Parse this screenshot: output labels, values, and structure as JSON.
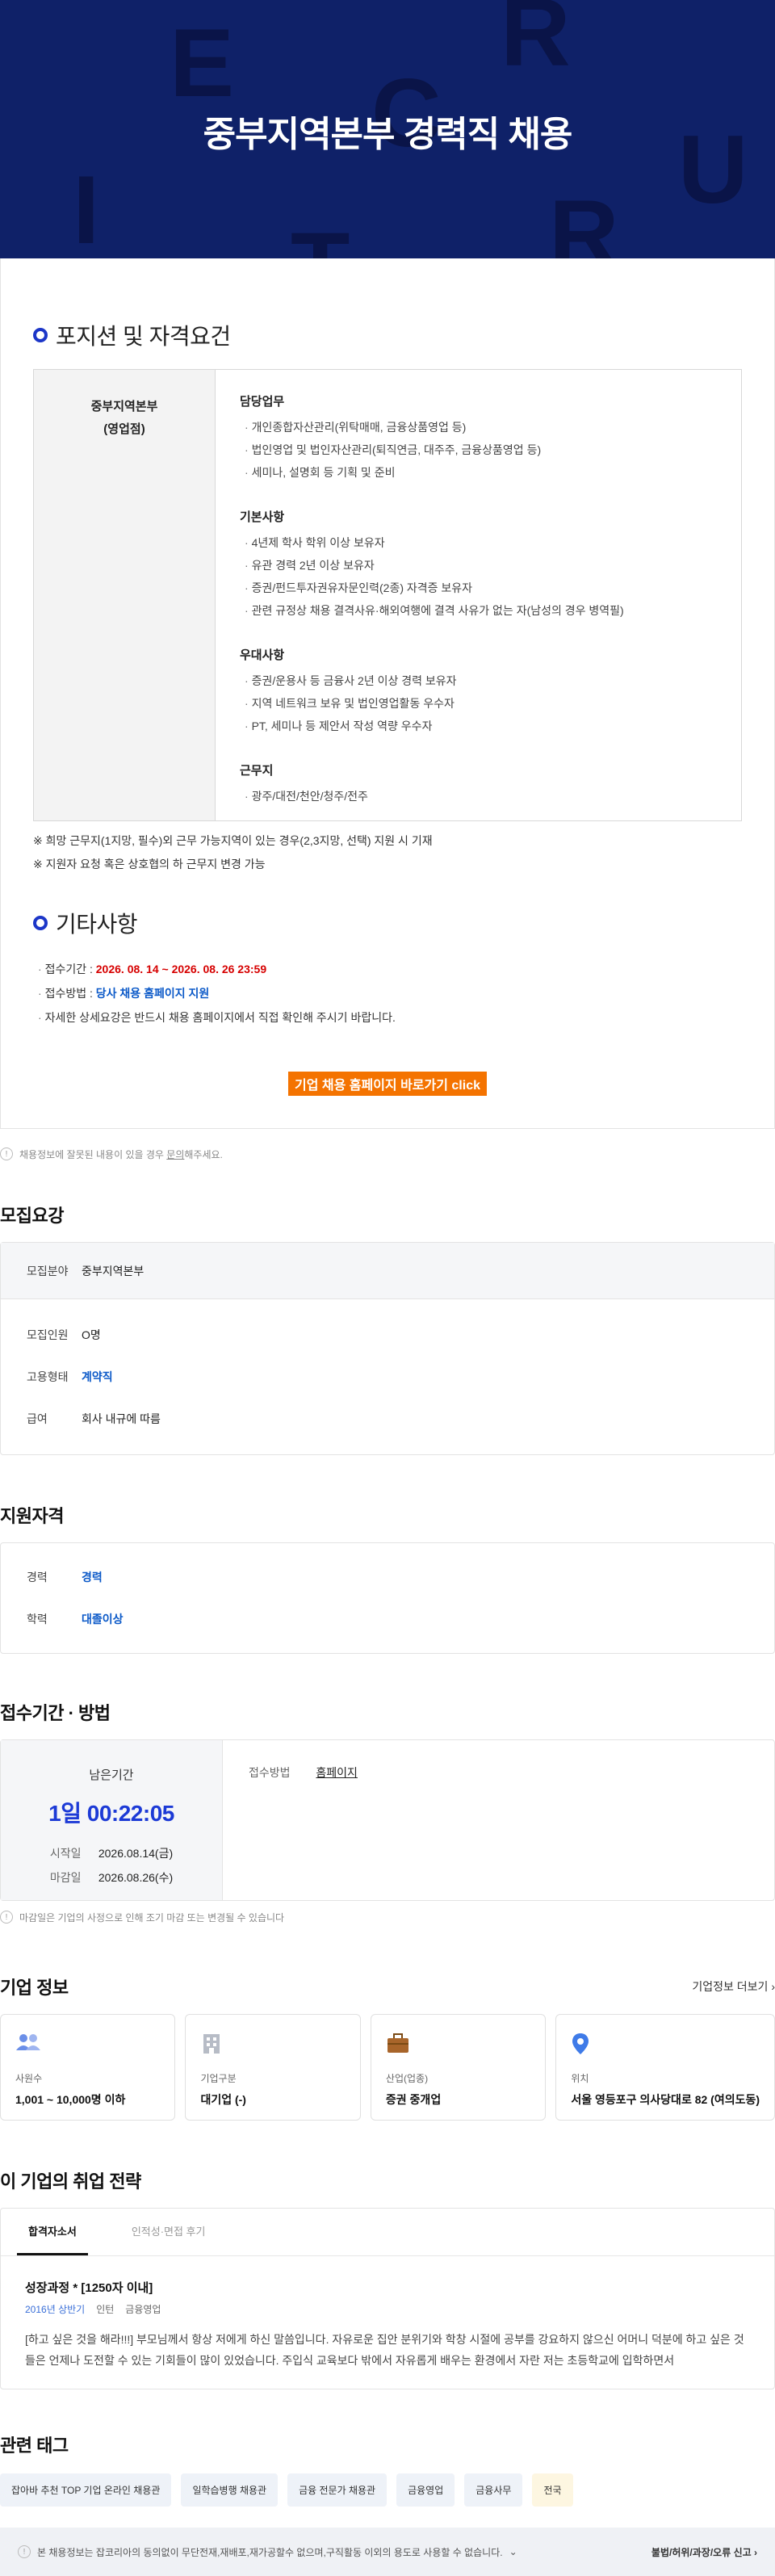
{
  "hero": {
    "title": "중부지역본부 경력직 채용",
    "bg_letters": [
      "E",
      "R",
      "C",
      "U",
      "I",
      "T",
      "R"
    ]
  },
  "position": {
    "section_title": "포지션 및 자격요건",
    "dept_line1": "중부지역본부",
    "dept_line2": "(영업점)",
    "groups": [
      {
        "title": "담당업무",
        "items": [
          "개인종합자산관리(위탁매매, 금융상품영업 등)",
          "법인영업 및 법인자산관리(퇴직연금, 대주주, 금융상품영업 등)",
          "세미나, 설명회 등 기획 및 준비"
        ]
      },
      {
        "title": "기본사항",
        "items": [
          "4년제 학사 학위 이상 보유자",
          "유관 경력 2년 이상 보유자",
          "증권/펀드투자권유자문인력(2종) 자격증 보유자",
          "관련 규정상 채용 결격사유·해외여행에 결격 사유가 없는 자(남성의 경우 병역필)"
        ]
      },
      {
        "title": "우대사항",
        "items": [
          "증권/운용사 등 금융사 2년 이상 경력 보유자",
          "지역 네트워크 보유 및 법인영업활동 우수자",
          "PT, 세미나 등 제안서 작성 역량 우수자"
        ]
      },
      {
        "title": "근무지",
        "items": [
          "광주/대전/천안/청주/전주"
        ]
      }
    ],
    "notes": [
      "※ 희망 근무지(1지망, 필수)외 근무 가능지역이 있는 경우(2,3지망, 선택) 지원 시 기재",
      "※ 지원자 요청 혹은 상호협의 하 근무지 변경 가능"
    ]
  },
  "etc": {
    "section_title": "기타사항",
    "period_label": "접수기간 : ",
    "period_value": "2026. 08. 14 ~ 2026. 08. 26 23:59",
    "method_label": "접수방법 : ",
    "method_value": "당사 채용 홈페이지 지원",
    "detail": "자세한 상세요강은 반드시 채용 홈페이지에서 직접 확인해 주시기 바랍니다.",
    "cta": "기업 채용 홈페이지 바로가기 click"
  },
  "report": {
    "pre": "채용정보에 잘못된 내용이 있을 경우 ",
    "link": "문의",
    "post": "해주세요."
  },
  "recruit": {
    "title": "모집요강",
    "rows": [
      {
        "label": "모집분야",
        "value": "중부지역본부",
        "blue": false
      },
      {
        "label": "모집인원",
        "value": "O명",
        "blue": false
      },
      {
        "label": "고용형태",
        "value": "계약직",
        "blue": true
      },
      {
        "label": "급여",
        "value": "회사 내규에 따름",
        "blue": false
      }
    ]
  },
  "qualification": {
    "title": "지원자격",
    "rows": [
      {
        "label": "경력",
        "value": "경력"
      },
      {
        "label": "학력",
        "value": "대졸이상"
      }
    ]
  },
  "apply": {
    "title": "접수기간 · 방법",
    "remain_label": "남은기간",
    "remain_value": "1일 00:22:05",
    "start_label": "시작일",
    "start_value": "2026.08.14(금)",
    "end_label": "마감일",
    "end_value": "2026.08.26(수)",
    "method_label": "접수방법",
    "method_value": "홈페이지",
    "notice": "마감일은 기업의 사정으로 인해 조기 마감 또는 변경될 수 있습니다"
  },
  "company": {
    "title": "기업 정보",
    "more": "기업정보 더보기",
    "cards": [
      {
        "icon": "people-icon",
        "label": "사원수",
        "value": "1,001 ~ 10,000명 이하"
      },
      {
        "icon": "building-icon",
        "label": "기업구분",
        "value": "대기업 (-)"
      },
      {
        "icon": "briefcase-icon",
        "label": "산업(업종)",
        "value": "증권 중개업"
      },
      {
        "icon": "location-pin-icon",
        "label": "위치",
        "value": "서울 영등포구 의사당대로 82 (여의도동)"
      }
    ]
  },
  "strategy": {
    "title": "이 기업의 취업 전략",
    "tabs": [
      "합격자소서",
      "인적성·면접 후기"
    ],
    "item_title": "성장과정 * [1250자 이내]",
    "meta_period": "2016년 상반기",
    "meta_type": "인턴",
    "meta_job": "금융영업",
    "text": "[하고 싶은 것을 해라!!!] 부모님께서 항상 저에게 하신 말씀입니다. 자유로운 집안 분위기와 학창 시절에 공부를 강요하지 않으신 어머니 덕분에 하고 싶은 것들은 언제나 도전할 수 있는 기회들이 많이 있었습니다. 주입식 교육보다 밖에서 자유롭게 배우는 환경에서 자란 저는 초등학교에 입학하면서"
  },
  "tags": {
    "title": "관련 태그",
    "items": [
      "잡아바 추천 TOP 기업 온라인 채용관",
      "일학습병행 채용관",
      "금융 전문가 채용관",
      "금융영업",
      "금융사무",
      "전국"
    ]
  },
  "footer": {
    "left": "본 채용정보는 잡코리아의 동의없이 무단전재,재배포,재가공할수 없으며,구직활동 이외의 용도로 사용할 수 없습니다.",
    "right": "불법/허위/과장/오류 신고"
  }
}
